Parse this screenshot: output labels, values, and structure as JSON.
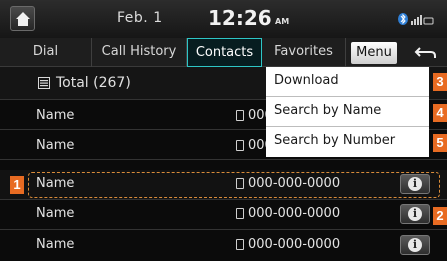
{
  "status_bar": {
    "date": "Feb.  1",
    "time": "12:26",
    "ampm": "AM",
    "icons": [
      "home-icon",
      "bluetooth-icon",
      "signal-icon"
    ]
  },
  "tabs": [
    {
      "label": "Dial",
      "active": false
    },
    {
      "label": "Call History",
      "active": false
    },
    {
      "label": "Contacts",
      "active": true
    },
    {
      "label": "Favorites",
      "active": false
    }
  ],
  "menu_label": "Menu",
  "back_icon": "back-arrow-icon",
  "total_label": "Total (267)",
  "contacts": [
    {
      "name": "Name",
      "number": "000-"
    },
    {
      "name": "Name",
      "number": "000-"
    },
    {
      "name": "Name",
      "number": "000-000-0000"
    },
    {
      "name": "Name",
      "number": "000-000-0000"
    },
    {
      "name": "Name",
      "number": "000-000-0000"
    }
  ],
  "dropdown": [
    "Download",
    "Search by Name",
    "Search by Number"
  ],
  "callouts": [
    "1",
    "2",
    "3",
    "4",
    "5"
  ],
  "colors": {
    "accent": "#2ec6c6",
    "callout": "#e86b22",
    "highlight": "#d98c3a"
  }
}
